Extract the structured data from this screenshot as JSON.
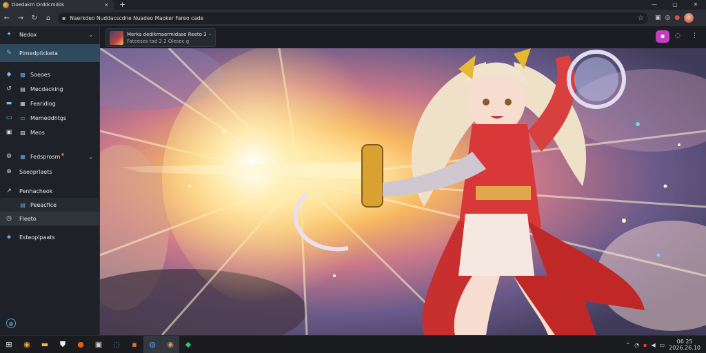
{
  "browser": {
    "tab_title": "Doedakm Drddcmdds",
    "url": "Naerkdeo Nuddacscdne Nuadeo Maoker Fareo cade",
    "window_controls": [
      "—",
      "▢",
      "✕"
    ]
  },
  "sidebar": {
    "header": "Nedox",
    "items": [
      {
        "label": "Pimedplicketa"
      },
      {
        "label": "Soeoes"
      },
      {
        "label": "Mecdacking"
      },
      {
        "label": "Fearidiog"
      },
      {
        "label": "Memeddhtgs"
      },
      {
        "label": "Meos"
      },
      {
        "label": "Fedsprosm"
      },
      {
        "label": "Saeoprlaets"
      },
      {
        "label": "Penhacheok"
      },
      {
        "label": "Peeacfice"
      },
      {
        "label": "Fleeto"
      },
      {
        "label": "Esteoplpaats"
      }
    ]
  },
  "content": {
    "card_title": "Merka dedikmaermidase Reeto 3",
    "card_sub": "Fateeses tad 2 2 Olesec g"
  },
  "taskbar": {
    "time": "06 25",
    "date": "2026.26.10"
  },
  "colors": {
    "accent": "#c040c0",
    "sidebar_active": "#2f4a5c",
    "art_glow": "#ffe9a8"
  }
}
